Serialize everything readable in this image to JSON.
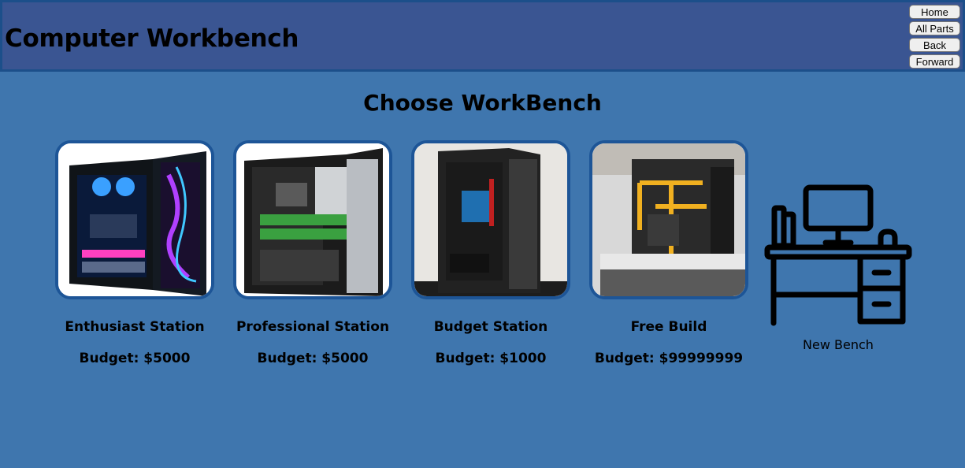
{
  "header": {
    "title": "Computer Workbench",
    "nav": {
      "home": "Home",
      "all_parts": "All Parts",
      "back": "Back",
      "forward": "Forward"
    }
  },
  "main": {
    "heading": "Choose WorkBench",
    "benches": [
      {
        "name": "Enthusiast Station",
        "budget": "Budget: $5000"
      },
      {
        "name": "Professional Station",
        "budget": "Budget: $5000"
      },
      {
        "name": "Budget Station",
        "budget": "Budget: $1000"
      },
      {
        "name": "Free Build",
        "budget": "Budget: $99999999"
      }
    ],
    "new_bench": {
      "label": "New Bench",
      "icon": "desk-computer-icon"
    }
  },
  "colors": {
    "background": "#3f76ae",
    "header": "#3a5592",
    "card_border": "#1d5597"
  }
}
